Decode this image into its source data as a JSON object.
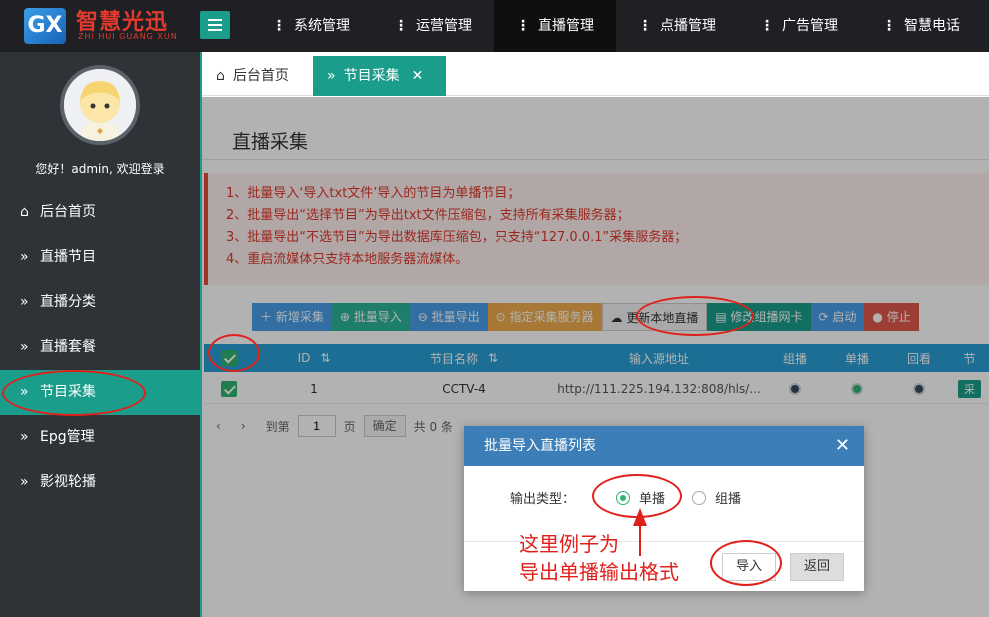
{
  "brand": {
    "title": "智慧光迅",
    "subtitle": "ZHI HUI GUANG XUN",
    "mark": "GX"
  },
  "topnav": [
    {
      "label": "系统管理",
      "active": false
    },
    {
      "label": "运营管理",
      "active": false
    },
    {
      "label": "直播管理",
      "active": true
    },
    {
      "label": "点播管理",
      "active": false
    },
    {
      "label": "广告管理",
      "active": false
    },
    {
      "label": "智慧电话",
      "active": false
    }
  ],
  "topnav_more": "⋮",
  "sidebar": {
    "welcome": "您好！admin, 欢迎登录",
    "items": [
      {
        "label": "后台首页",
        "icon": "home-icon",
        "active": false
      },
      {
        "label": "直播节目",
        "icon": "double-chevron-icon",
        "active": false
      },
      {
        "label": "直播分类",
        "icon": "double-chevron-icon",
        "active": false
      },
      {
        "label": "直播套餐",
        "icon": "double-chevron-icon",
        "active": false
      },
      {
        "label": "节目采集",
        "icon": "double-chevron-icon",
        "active": true
      },
      {
        "label": "Epg管理",
        "icon": "double-chevron-icon",
        "active": false
      },
      {
        "label": "影视轮播",
        "icon": "double-chevron-icon",
        "active": false
      }
    ]
  },
  "tabs": [
    {
      "label": "后台首页",
      "icon": "home-icon",
      "active": false
    },
    {
      "label": "节目采集",
      "icon": "double-chevron-icon",
      "active": true
    }
  ],
  "page": {
    "title": "直播采集",
    "notices": [
      "1、批量导入‘导入txt文件’导入的节目为单播节目；",
      "2、批量导出“选择节目”为导出txt文件压缩包，支持所有采集服务器；",
      "3、批量导出“不选节目”为导出数据库压缩包，只支持“127.0.0.1”采集服务器；",
      "4、重启流媒体只支持本地服务器流媒体。"
    ],
    "toolbar": [
      {
        "label": "新增采集",
        "icon": "plus-icon"
      },
      {
        "label": "批量导入",
        "icon": "import-icon"
      },
      {
        "label": "批量导出",
        "icon": "export-icon"
      },
      {
        "label": "指定采集服务器",
        "icon": "server-icon"
      },
      {
        "label": "更新本地直播",
        "icon": "cloud-icon"
      },
      {
        "label": "修改组播网卡",
        "icon": "network-icon"
      },
      {
        "label": "启动",
        "icon": "start-icon"
      },
      {
        "label": "停止",
        "icon": "stop-icon"
      }
    ]
  },
  "grid": {
    "columns": [
      "",
      "ID",
      "节目名称",
      "输入源地址",
      "组播",
      "单播",
      "回看",
      "节"
    ],
    "rows": [
      {
        "checked": true,
        "id": "1",
        "name": "CCTV-4",
        "source": "http://111.225.194.132:808/hls/...",
        "multicast": "off",
        "unicast": "on",
        "replay": "off",
        "tag": "采"
      }
    ]
  },
  "pager": {
    "goto_label": "到第",
    "page_value": "1",
    "page_unit": "页",
    "confirm": "确定",
    "total": "共 0 条"
  },
  "modal": {
    "title": "批量导入直播列表",
    "close": "✕",
    "field_label": "输出类型：",
    "options": [
      {
        "label": "单播",
        "selected": true
      },
      {
        "label": "组播",
        "selected": false
      }
    ],
    "import_button": "导入",
    "back_button": "返回"
  },
  "annotation": {
    "line1": "这里例子为",
    "line2": "导出单播输出格式",
    "color": "#e0201b"
  },
  "colors": {
    "accent": "#1a9e8b",
    "topbar": "#1f2023",
    "sidebar": "#2f3237",
    "modal_header": "#3c7fb8",
    "notice_text": "#e0392b"
  }
}
